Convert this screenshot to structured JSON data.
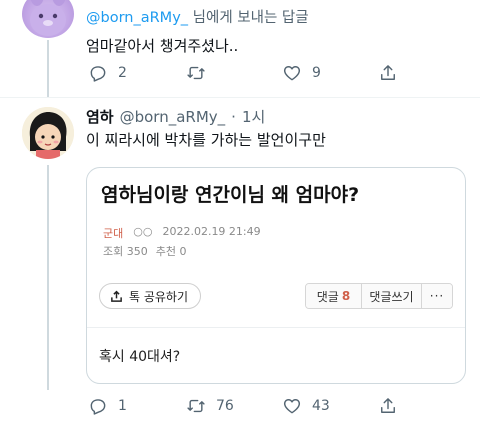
{
  "reply_context": {
    "handle": "@born_aRMy_",
    "suffix": " 님에게 보내는 답글"
  },
  "first_tweet": {
    "text": "엄마같아서 챙겨주셨나..",
    "actions": {
      "reply_count": "2",
      "retweet_count": "",
      "like_count": "9"
    }
  },
  "second_tweet": {
    "author_name": "염하",
    "author_handle": "@born_aRMy_",
    "separator": "·",
    "time": "1시",
    "text": "이 찌라시에 박차를 가하는 발언이구만",
    "card": {
      "title": "염하님이랑 연간이님 왜 엄마야?",
      "category": "군대",
      "author_masked": "○○",
      "date": "2022.02.19 21:49",
      "views_label": "조회 350",
      "recommend_label": "추천 0",
      "share_label": "톡 공유하기",
      "comment_label": "댓글",
      "comment_count": "8",
      "write_comment_label": "댓글쓰기",
      "more_label": "···",
      "comment_text": "혹시 40대셔?"
    },
    "actions": {
      "reply_count": "1",
      "retweet_count": "76",
      "like_count": "43"
    }
  },
  "colors": {
    "link_blue": "#1d9bf0",
    "muted_gray": "#536471",
    "thread_line": "#cfd9de",
    "category_red": "#d0604a"
  }
}
